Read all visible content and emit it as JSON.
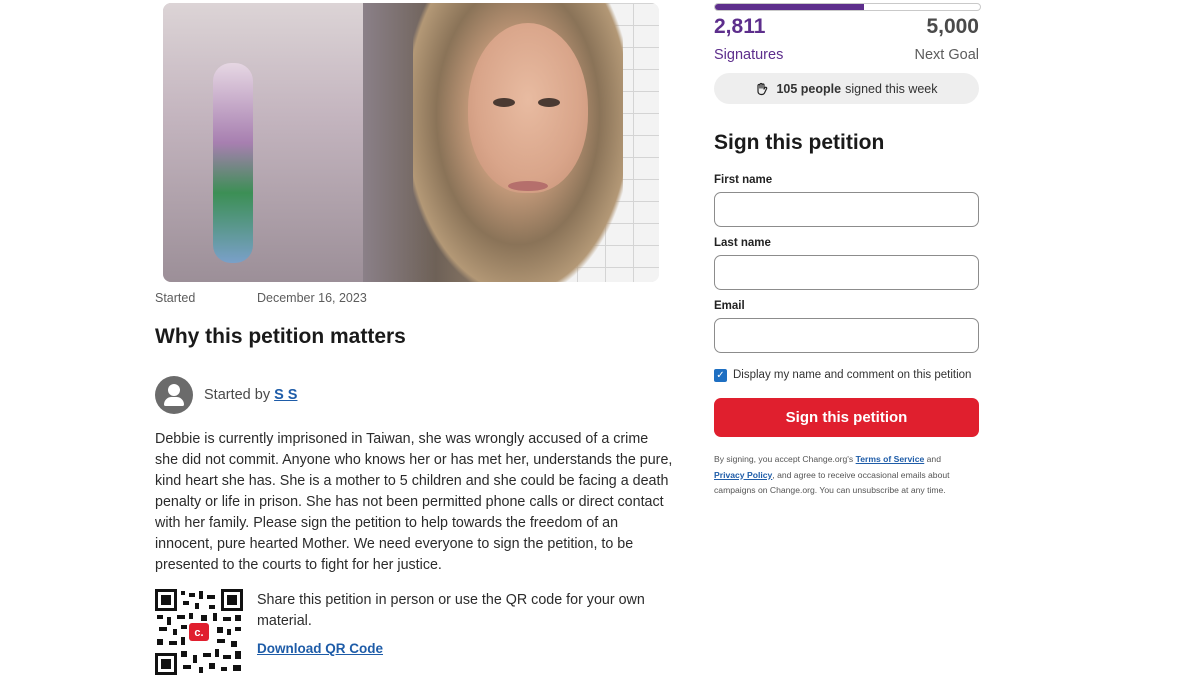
{
  "petition": {
    "started_label": "Started",
    "started_date": "December 16, 2023",
    "why_heading": "Why this petition matters",
    "started_by_prefix": "Started by",
    "author_name": "S S",
    "description": "Debbie is currently imprisoned in Taiwan, she was wrongly accused of a crime she did not commit. Anyone who knows her or has met her, understands the pure, kind heart she has. She is a mother to 5 children and she could be facing a death penalty or life in prison. She has not been permitted phone calls or direct contact with her family. Please sign the petition to help towards the freedom of an innocent, pure hearted Mother. We need everyone to sign the petition, to be presented to the courts to fight for her justice.",
    "share_text": "Share this petition in person or use the QR code for your own material.",
    "download_qr_label": "Download QR Code"
  },
  "progress": {
    "signatures": "2,811",
    "signatures_label": "Signatures",
    "goal": "5,000",
    "goal_label": "Next Goal",
    "fraction": 0.562,
    "weekly_count": "105 people",
    "weekly_suffix": "signed this week",
    "accent_color": "#5d2e8c"
  },
  "form": {
    "heading": "Sign this petition",
    "first_name_label": "First name",
    "first_name_value": "",
    "last_name_label": "Last name",
    "last_name_value": "",
    "email_label": "Email",
    "email_value": "",
    "display_checkbox_label": "Display my name and comment on this petition",
    "display_checked": true,
    "submit_label": "Sign this petition",
    "submit_color": "#e01f2e"
  },
  "legal": {
    "part1": "By signing, you accept Change.org's",
    "terms_link": "Terms of Service",
    "part2": "and",
    "privacy_link": "Privacy Policy",
    "part3": ", and agree to receive occasional emails about campaigns on Change.org. You can unsubscribe at any time."
  },
  "icons": {
    "avatar": "user-avatar-icon",
    "weekly": "hand-icon",
    "qr": "qr-code-icon"
  }
}
